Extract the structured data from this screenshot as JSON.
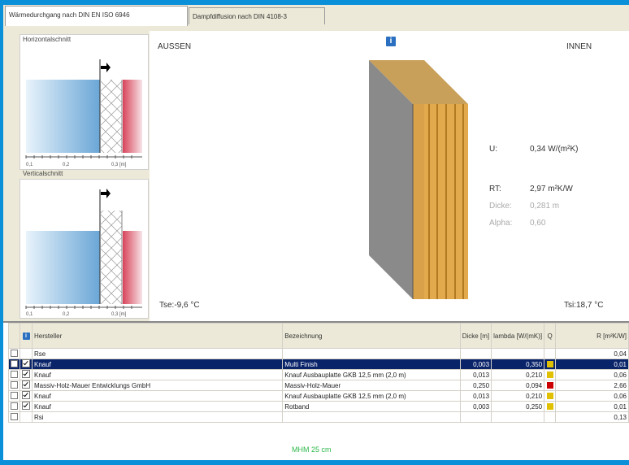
{
  "tabs": [
    {
      "label": "Wärmedurchgang nach DIN EN ISO 6946",
      "active": true
    },
    {
      "label": "Dampfdiffusion nach DIN 4108-3",
      "active": false
    }
  ],
  "sections": {
    "horizontal": "Horizontalschnitt",
    "vertical": "Verticalschnitt"
  },
  "axis_ticks": [
    "0,1",
    "0,2",
    "0,3 [m]"
  ],
  "canvas": {
    "outside": "AUSSEN",
    "inside": "INNEN",
    "tse": "Tse:-9,6 °C",
    "tsi": "Tsi:18,7 °C",
    "props": [
      {
        "label": "U:",
        "value": "0,34 W/(m²K)",
        "dim": false
      },
      {
        "label": "RT:",
        "value": "2,97 m²K/W",
        "dim": false
      },
      {
        "label": "Dicke:",
        "value": "0,281 m",
        "dim": true
      },
      {
        "label": "Alpha:",
        "value": "0,60",
        "dim": true
      }
    ]
  },
  "table": {
    "headers": {
      "hersteller": "Hersteller",
      "bezeichnung": "Bezeichnung",
      "dicke": "Dicke [m]",
      "lambda": "lambda [W/(mK)]",
      "q": "Q",
      "r": "R [m²K/W]"
    },
    "rows": [
      {
        "checked": false,
        "hersteller": "Rse",
        "bezeichnung": "",
        "dicke": "",
        "lambda": "",
        "q_color": "",
        "r": "0,04",
        "selected": false
      },
      {
        "checked": true,
        "hersteller": "Knauf",
        "bezeichnung": "Multi Finish",
        "dicke": "0,003",
        "lambda": "0,350",
        "q_color": "#e0c000",
        "r": "0,01",
        "selected": true
      },
      {
        "checked": true,
        "hersteller": "Knauf",
        "bezeichnung": "Knauf Ausbauplatte GKB 12,5 mm (2,0 m)",
        "dicke": "0,013",
        "lambda": "0,210",
        "q_color": "#e0c000",
        "r": "0,06",
        "selected": false
      },
      {
        "checked": true,
        "hersteller": "Massiv-Holz-Mauer Entwicklungs GmbH",
        "bezeichnung": "Massiv-Holz-Mauer",
        "dicke": "0,250",
        "lambda": "0,094",
        "q_color": "#cc0000",
        "r": "2,66",
        "selected": false
      },
      {
        "checked": true,
        "hersteller": "Knauf",
        "bezeichnung": "Knauf Ausbauplatte GKB 12,5 mm (2,0 m)",
        "dicke": "0,013",
        "lambda": "0,210",
        "q_color": "#e0c000",
        "r": "0,06",
        "selected": false
      },
      {
        "checked": true,
        "hersteller": "Knauf",
        "bezeichnung": "Rotband",
        "dicke": "0,003",
        "lambda": "0,250",
        "q_color": "#e0c000",
        "r": "0,01",
        "selected": false
      },
      {
        "checked": false,
        "hersteller": "Rsi",
        "bezeichnung": "",
        "dicke": "",
        "lambda": "",
        "q_color": "",
        "r": "0,13",
        "selected": false
      }
    ]
  },
  "footer_text": "MHM 25 cm",
  "colors": {
    "accent": "#0a8fd9",
    "selection": "#0a246a",
    "footer": "#2db84a"
  }
}
